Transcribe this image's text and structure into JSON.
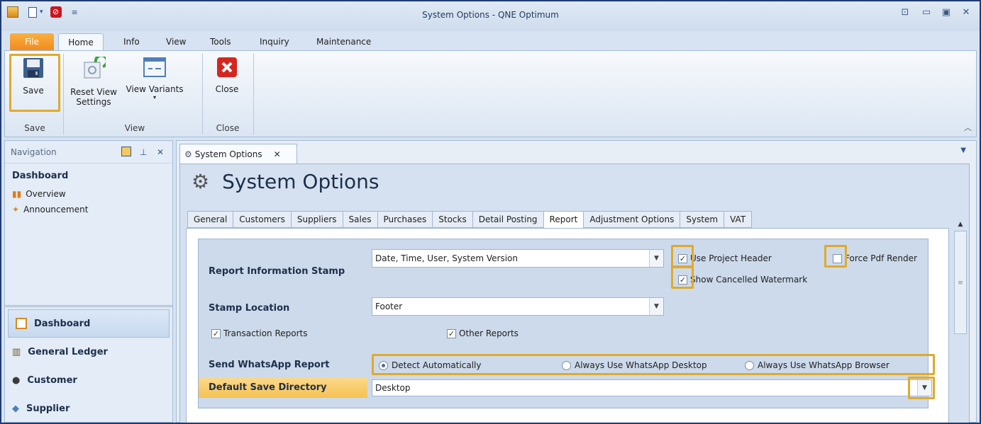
{
  "window": {
    "title": "System Options - QNE Optimum"
  },
  "ribbon_tabs": [
    "File",
    "Home",
    "Info",
    "View",
    "Tools",
    "Inquiry",
    "Maintenance"
  ],
  "ribbon": {
    "save_label": "Save",
    "reset_label_1": "Reset View",
    "reset_label_2": "Settings",
    "variants_label": "View Variants",
    "close_label": "Close",
    "group_save": "Save",
    "group_view": "View",
    "group_close": "Close"
  },
  "nav": {
    "title": "Navigation",
    "section": "Dashboard",
    "links": [
      "Overview",
      "Announcement"
    ],
    "big_items": [
      "Dashboard",
      "General Ledger",
      "Customer",
      "Supplier"
    ]
  },
  "doc_tab": "System Options",
  "page_title": "System Options",
  "sub_tabs": [
    "General",
    "Customers",
    "Suppliers",
    "Sales",
    "Purchases",
    "Stocks",
    "Detail Posting",
    "Report",
    "Adjustment Options",
    "System",
    "VAT"
  ],
  "selected_sub_tab": "Report",
  "form": {
    "report_info_label": "Report Information Stamp",
    "report_info_value": "Date, Time, User, System Version",
    "use_project_header": "Use Project Header",
    "force_pdf": "Force Pdf Render",
    "show_cancelled": "Show Cancelled Watermark",
    "stamp_location_label": "Stamp Location",
    "stamp_location_value": "Footer",
    "transaction_reports": "Transaction Reports",
    "other_reports": "Other Reports",
    "whatsapp_label": "Send WhatsApp Report",
    "wa_opt1": "Detect Automatically",
    "wa_opt2": "Always Use WhatsApp Desktop",
    "wa_opt3": "Always Use WhatsApp Browser",
    "save_dir_label": "Default Save Directory",
    "save_dir_value": "Desktop"
  },
  "colors": {
    "highlight": "#e0aa2a",
    "file_tab": "#f08a1e"
  }
}
